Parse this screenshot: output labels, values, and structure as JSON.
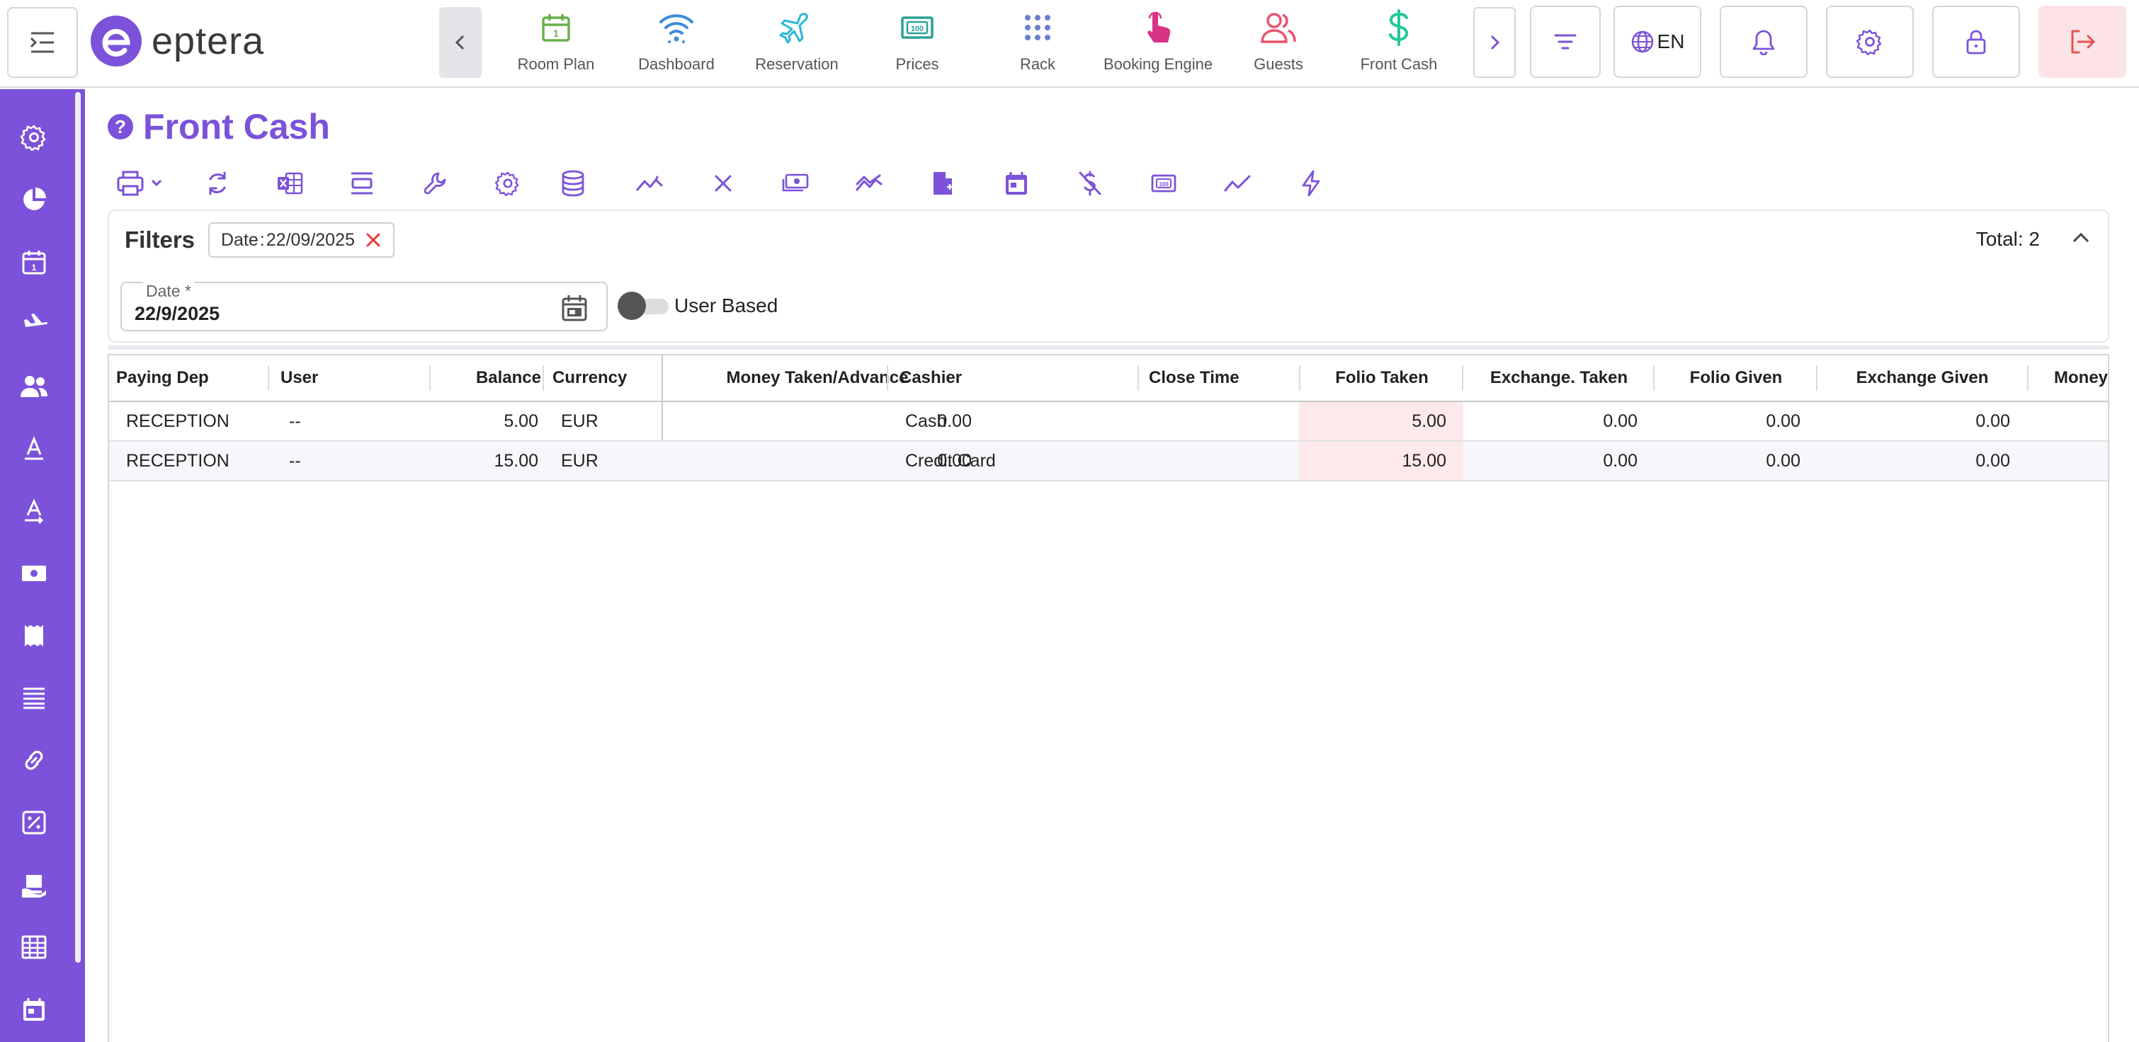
{
  "app": {
    "logo_text": "eptera",
    "brand_color": "#7b52d9"
  },
  "nav": {
    "items": [
      {
        "label": "Room Plan",
        "icon": "calendar-icon",
        "color": "#6ab04c"
      },
      {
        "label": "Dashboard",
        "icon": "wifi-icon",
        "color": "#3d8bd8"
      },
      {
        "label": "Reservation",
        "icon": "plane-icon",
        "color": "#29b6d8"
      },
      {
        "label": "Prices",
        "icon": "banknote-icon",
        "color": "#2aa198"
      },
      {
        "label": "Rack",
        "icon": "grid-dots-icon",
        "color": "#6a7fd0"
      },
      {
        "label": "Booking Engine",
        "icon": "touch-icon",
        "color": "#d63384"
      },
      {
        "label": "Guests",
        "icon": "users-icon",
        "color": "#e8556d"
      },
      {
        "label": "Front Cash",
        "icon": "dollar-icon",
        "color": "#20c997"
      }
    ]
  },
  "topbar": {
    "language": "EN"
  },
  "page": {
    "title": "Front Cash"
  },
  "filters": {
    "label": "Filters",
    "chip_key": "Date",
    "chip_sep": ":",
    "chip_value": "22/09/2025",
    "total_label": "Total: 2",
    "date_label": "Date *",
    "date_value": "22/9/2025",
    "toggle_label": "User Based",
    "toggle_on": false
  },
  "table": {
    "columns": [
      "Paying Dep",
      "User",
      "Balance",
      "Currency",
      "Money Taken/Advance",
      "Cashier",
      "Close Time",
      "Folio Taken",
      "Exchange. Taken",
      "Folio Given",
      "Exchange Given",
      "Money"
    ],
    "rows": [
      {
        "paying_dep": "RECEPTION",
        "user": "--",
        "balance": "5.00",
        "currency": "EUR",
        "money_taken": "0.00",
        "cashier": "Cash",
        "close_time": "",
        "folio_taken": "5.00",
        "exchange_taken": "0.00",
        "folio_given": "0.00",
        "exchange_given": "0.00",
        "money": ""
      },
      {
        "paying_dep": "RECEPTION",
        "user": "--",
        "balance": "15.00",
        "currency": "EUR",
        "money_taken": "0.00",
        "cashier": "Credit Card",
        "close_time": "",
        "folio_taken": "15.00",
        "exchange_taken": "0.00",
        "folio_given": "0.00",
        "exchange_given": "0.00",
        "money": ""
      }
    ]
  }
}
